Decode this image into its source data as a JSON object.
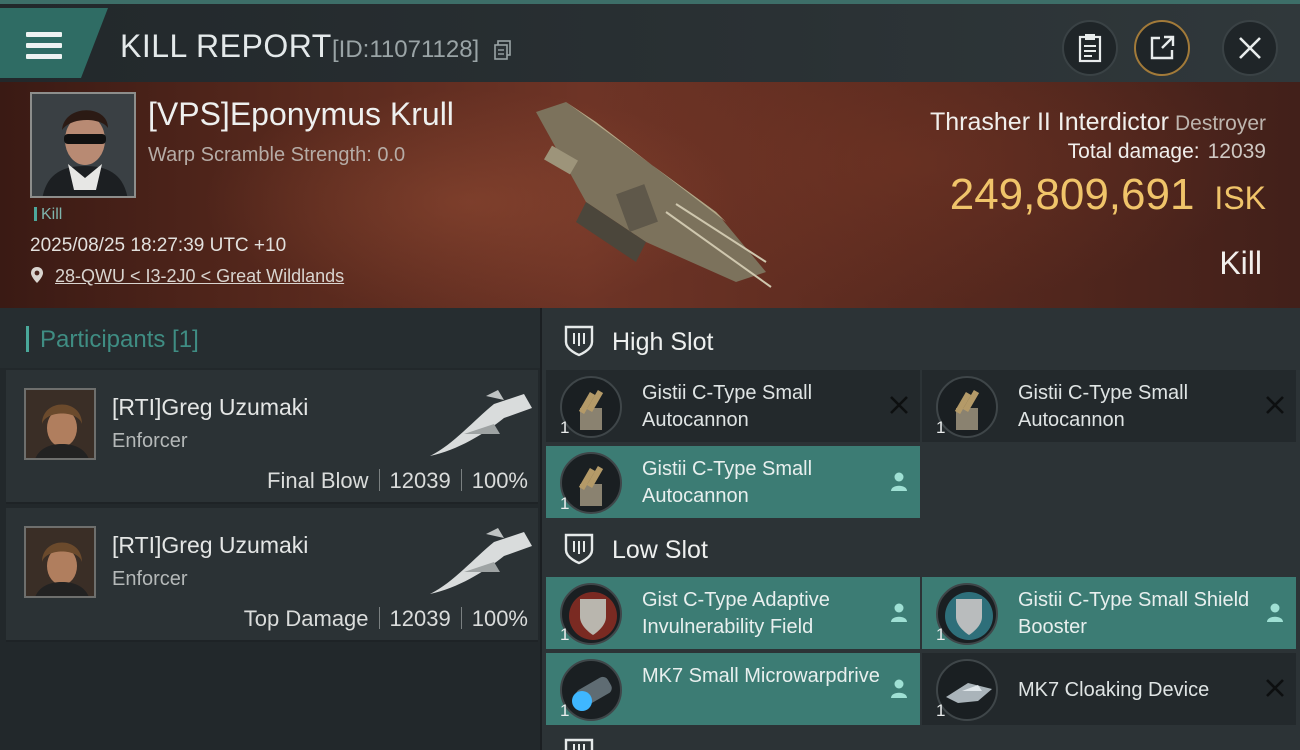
{
  "header": {
    "title": "KILL REPORT",
    "id_text": "[ID:11071128]"
  },
  "victim": {
    "name": "[VPS]Eponymus Krull",
    "warp_scramble": "Warp Scramble Strength: 0.0",
    "tag": "Kill",
    "datetime": "2025/08/25 18:27:39 UTC +10",
    "location": "28-QWU < I3-2J0 < Great Wildlands",
    "ship_name": "Thrasher II Interdictor",
    "ship_class": "Destroyer",
    "total_damage_label": "Total damage:",
    "total_damage": "12039",
    "isk_value": "249,809,691",
    "isk_unit": "ISK",
    "result": "Kill"
  },
  "participants": {
    "header": "Participants [1]",
    "rows": [
      {
        "name": "[RTI]Greg Uzumaki",
        "role": "Enforcer",
        "label": "Final Blow",
        "damage": "12039",
        "percent": "100%"
      },
      {
        "name": "[RTI]Greg Uzumaki",
        "role": "Enforcer",
        "label": "Top Damage",
        "damage": "12039",
        "percent": "100%"
      }
    ]
  },
  "fitting": {
    "high_slot_label": "High Slot",
    "low_slot_label": "Low Slot",
    "high": [
      {
        "name": "Gistii C-Type Small Autocannon",
        "qty": "1",
        "state": "destroyed"
      },
      {
        "name": "Gistii C-Type Small Autocannon",
        "qty": "1",
        "state": "destroyed"
      },
      {
        "name": "Gistii C-Type Small Autocannon",
        "qty": "1",
        "state": "dropped"
      }
    ],
    "low": [
      {
        "name": "Gist C-Type Adaptive Invulnerability Field",
        "qty": "1",
        "state": "dropped"
      },
      {
        "name": "Gistii C-Type Small Shield Booster",
        "qty": "1",
        "state": "dropped"
      },
      {
        "name": "MK7 Small Microwarpdrive",
        "qty": "1",
        "state": "dropped"
      },
      {
        "name": "MK7 Cloaking Device",
        "qty": "1",
        "state": "destroyed"
      }
    ]
  },
  "colors": {
    "accent_teal": "#3c7c74",
    "isk_gold": "#f0c46a",
    "hero_red": "#5a2a1e"
  },
  "icons": [
    "menu-icon",
    "copy-icon",
    "clipboard-icon",
    "share-icon",
    "close-icon",
    "location-pin-icon",
    "shield-slot-icon",
    "destroyed-x-icon",
    "dropped-person-icon"
  ]
}
